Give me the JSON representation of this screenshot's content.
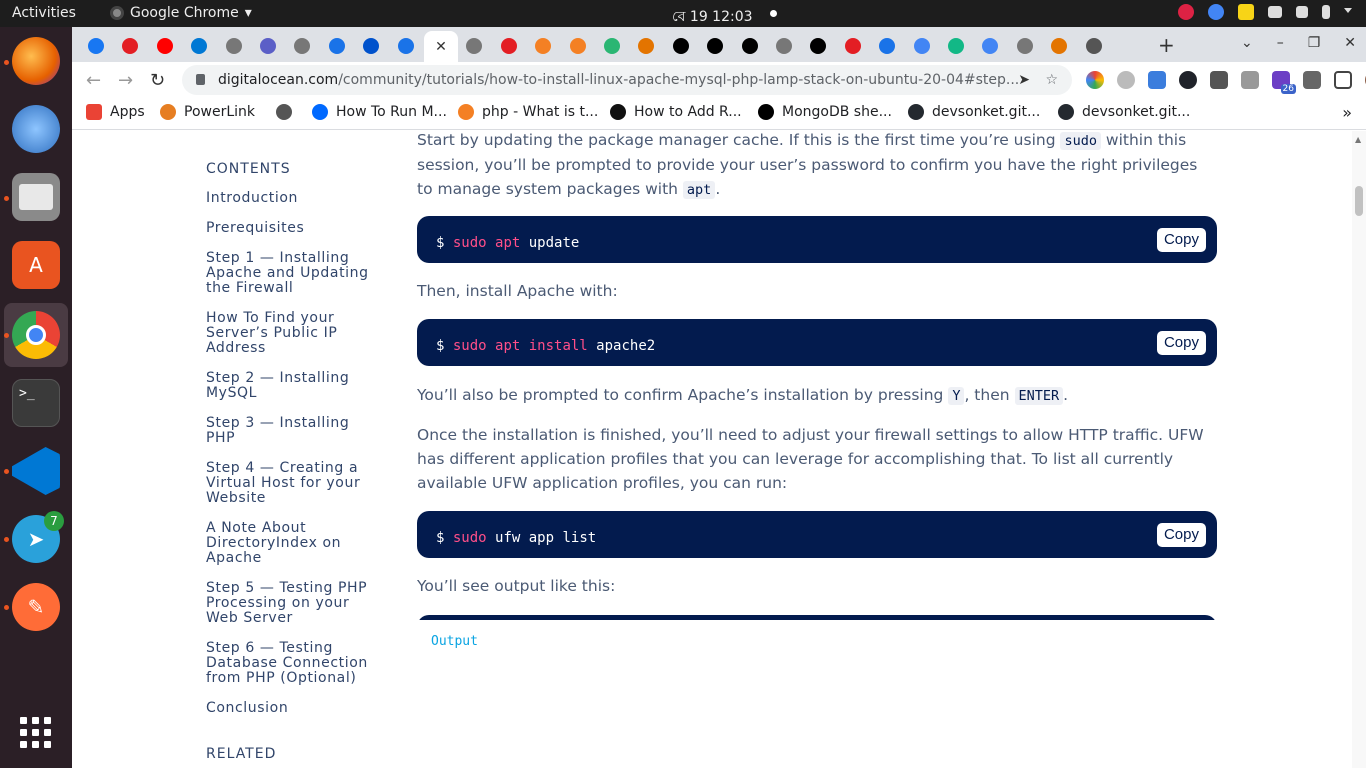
{
  "topbar": {
    "activities": "Activities",
    "app_name": "Google Chrome",
    "clock": "বে 19  12:03"
  },
  "dock": {
    "items": [
      {
        "name": "firefox-icon",
        "color": "#e66000"
      },
      {
        "name": "thunderbird-icon",
        "color": "#2f6fbf"
      },
      {
        "name": "files-icon",
        "color": "#7a7a7a"
      },
      {
        "name": "software-icon",
        "color": "#e95420"
      },
      {
        "name": "chrome-icon",
        "color": "#4285f4"
      },
      {
        "name": "terminal-icon",
        "color": "#2c2c2c"
      },
      {
        "name": "vscode-icon",
        "color": "#0078d4"
      },
      {
        "name": "telegram-icon",
        "color": "#2aa1da"
      },
      {
        "name": "postman-icon",
        "color": "#ff6c37"
      }
    ],
    "telegram_badge": "7"
  },
  "tabs": {
    "favicon_colors": [
      "#1877f2",
      "#e31e24",
      "#ff0000",
      "#0078d4",
      "#777",
      "#5b5fc7",
      "#777",
      "#1a73e8",
      "#0052cc",
      "#1a73e8",
      "#fff",
      "#777",
      "#e31e24",
      "#f48024",
      "#f48024",
      "#2ab673",
      "#e37400",
      "#000",
      "#000",
      "#000",
      "#777",
      "#000",
      "#e31e24",
      "#1a73e8",
      "#4285f4",
      "#12b886",
      "#4285f4",
      "#777",
      "#e37400",
      "#555"
    ],
    "new_tab": "+"
  },
  "address_bar": {
    "domain": "digitalocean.com",
    "path": "/community/tutorials/how-to-install-linux-apache-mysql-php-lamp-stack-on-ubuntu-20-04#step...",
    "ext_badge": "26"
  },
  "bookmarks": [
    {
      "label": "Apps",
      "color": "#ea4335"
    },
    {
      "label": "PowerLink",
      "color": "#e67e22"
    },
    {
      "label": "",
      "color": "#555"
    },
    {
      "label": "How To Run M...",
      "color": "#0069ff"
    },
    {
      "label": "php - What is t...",
      "color": "#f48024"
    },
    {
      "label": "How to Add R...",
      "color": "#111"
    },
    {
      "label": "MongoDB she...",
      "color": "#000"
    },
    {
      "label": "devsonket.git...",
      "color": "#24292f"
    },
    {
      "label": "devsonket.git...",
      "color": "#24292f"
    }
  ],
  "toc": {
    "heading": "CONTENTS",
    "items": [
      "Introduction",
      "Prerequisites",
      "Step 1 — Installing Apache and Updating the Firewall",
      "How To Find your Server’s Public IP Address",
      "Step 2 — Installing MySQL",
      "Step 3 — Installing PHP",
      "Step 4 — Creating a Virtual Host for your Website",
      "A Note About DirectoryIndex on Apache",
      "Step 5 — Testing PHP Processing on your Web Server",
      "Step 6 — Testing Database Connection from PHP (Optional)",
      "Conclusion"
    ],
    "related": "RELATED"
  },
  "article": {
    "p1_a": "Start by updating the package manager cache. If this is the first time you’re using ",
    "p1_code1": "sudo",
    "p1_b": " within this session, you’ll be prompted to provide your user’s password to confirm you have the right privileges to manage system packages with ",
    "p1_code2": "apt",
    "p1_c": ".",
    "cmd1": {
      "prompt": "$",
      "kw": "sudo apt",
      "rest": "update"
    },
    "p2": "Then, install Apache with:",
    "cmd2": {
      "prompt": "$",
      "kw": "sudo apt install",
      "rest": "apache2"
    },
    "p3_a": "You’ll also be prompted to confirm Apache’s installation by pressing ",
    "p3_code1": "Y",
    "p3_b": ", then ",
    "p3_code2": "ENTER",
    "p3_c": ".",
    "p4": "Once the installation is finished, you’ll need to adjust your firewall settings to allow HTTP traffic. UFW has different application profiles that you can leverage for accomplishing that. To list all currently available UFW application profiles, you can run:",
    "cmd3": {
      "prompt": "$",
      "kw": "sudo",
      "rest": "ufw app list"
    },
    "p5": "You’ll see output like this:",
    "output_label": "Output",
    "copy_label": "Copy"
  }
}
